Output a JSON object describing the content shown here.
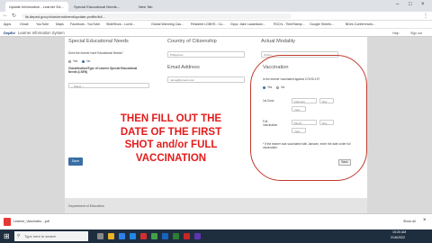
{
  "browser": {
    "tabs": [
      "Update Information - Learner Ed...",
      "Special Educational Needs...",
      "New Tab"
    ],
    "url": "lis.deped.gov.ph/uis/enrolment/update-profile/lid/...",
    "bookmarks": [
      "Apps",
      "Gmail",
      "YouTube",
      "Maps",
      "Facebook - YouTube",
      "SlideShow - Lurnit...",
      "Global Warming Cau...",
      "Resident LGBHS - Cu...",
      "Gspv. Jake Lacanilaon...",
      "RCD's - TimeStamp...",
      "Google Sheets...",
      "BDes Conferences..."
    ]
  },
  "lis": {
    "title": "Learner Information System",
    "help": "Help",
    "signout": "Sign out"
  },
  "form": {
    "special_needs_title": "Special Educational Needs",
    "special_needs_question": "Does the learner have Educational Needs?",
    "opt_yes": "Yes",
    "opt_no": "No",
    "classification_label": "Classification/Type of Learner Special Educational Needs (LSEN)",
    "classification_value": "-- Select --",
    "citizenship_title": "Country of Citizenship",
    "citizenship_value": "Philippines",
    "email_title": "Email Address",
    "email_placeholder": "name@domain.com",
    "modality_title": "Actual Modality",
    "modality_value": "Online",
    "save_label": "Save"
  },
  "vaccination": {
    "title": "Vaccination",
    "question": "Is the learner vaccinated against COVID-19?",
    "opt_yes": "Yes",
    "opt_no": "No",
    "first_dose_label": "1st Dose",
    "first_month": "February",
    "first_day": "Day",
    "first_year": "Year",
    "full_label": "Full Vaccination",
    "full_month": "Month",
    "full_day": "Day",
    "full_year": "Year",
    "note": "* If the learner was vaccinated with Janssen, enter the date under full vaccination.",
    "back_label": "Back"
  },
  "overlay": {
    "line1": "THEN FILL OUT THE",
    "line2": "DATE OF THE FIRST",
    "line3": "SHOT and/or  FULL",
    "line4": "VACCINATION"
  },
  "footer": {
    "text": "Department of Education"
  },
  "download": {
    "file": "Learner_Vaccinatio....pdf",
    "show_all": "Show all"
  },
  "taskbar": {
    "search": "Type here to search",
    "time": "10:20 AM",
    "date": "2/16/2022"
  },
  "colors": {
    "accent": "#3a6ea5",
    "overlay_red": "#e31b1b",
    "circle": "#c0392b"
  }
}
